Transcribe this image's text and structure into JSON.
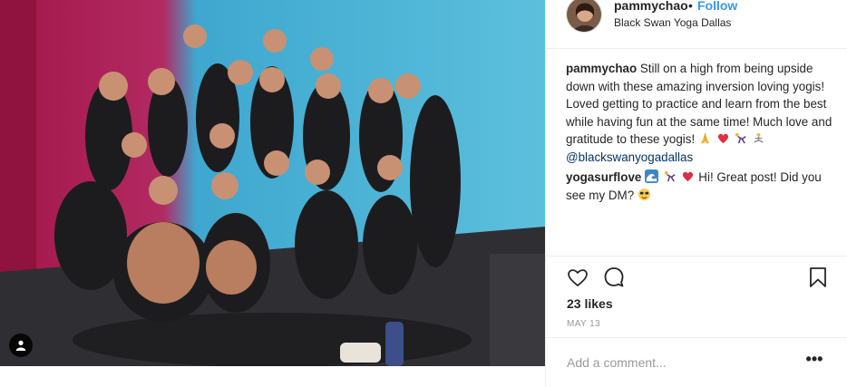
{
  "post": {
    "username": "pammychao",
    "separator": "•",
    "follow_label": "Follow",
    "location": "Black Swan Yoga Dallas",
    "photo_alt": "Group photo at Black Swan Yoga Dallas"
  },
  "comments": [
    {
      "username": "pammychao",
      "text": "Still on a high from being upside down with these amazing inversion loving yogis! Loved getting to practice and learn from the best while having fun at the same time! Much love and gratitude to these yogis!",
      "emojis": [
        "folded-hands",
        "red-heart",
        "person-doing-cartwheel",
        "woman-in-lotus"
      ],
      "mention": "@blackswanyogadallas"
    },
    {
      "username": "yogasurflove",
      "emojis": [
        "water-wave",
        "person-doing-cartwheel",
        "red-heart"
      ],
      "text": "Hi! Great post! Did you see my DM?",
      "trailing_emoji": "smiling-face-with-sunglasses"
    }
  ],
  "actions": {
    "likes": "23 likes",
    "date": "MAY 13"
  },
  "add_comment": {
    "placeholder": "Add a comment...",
    "more_label": "•••"
  },
  "colors": {
    "link": "#3897f0",
    "mention": "#003569",
    "wall_left": "#a3174a",
    "wall_right": "#4fb5d6",
    "meta_gray": "#999999"
  }
}
